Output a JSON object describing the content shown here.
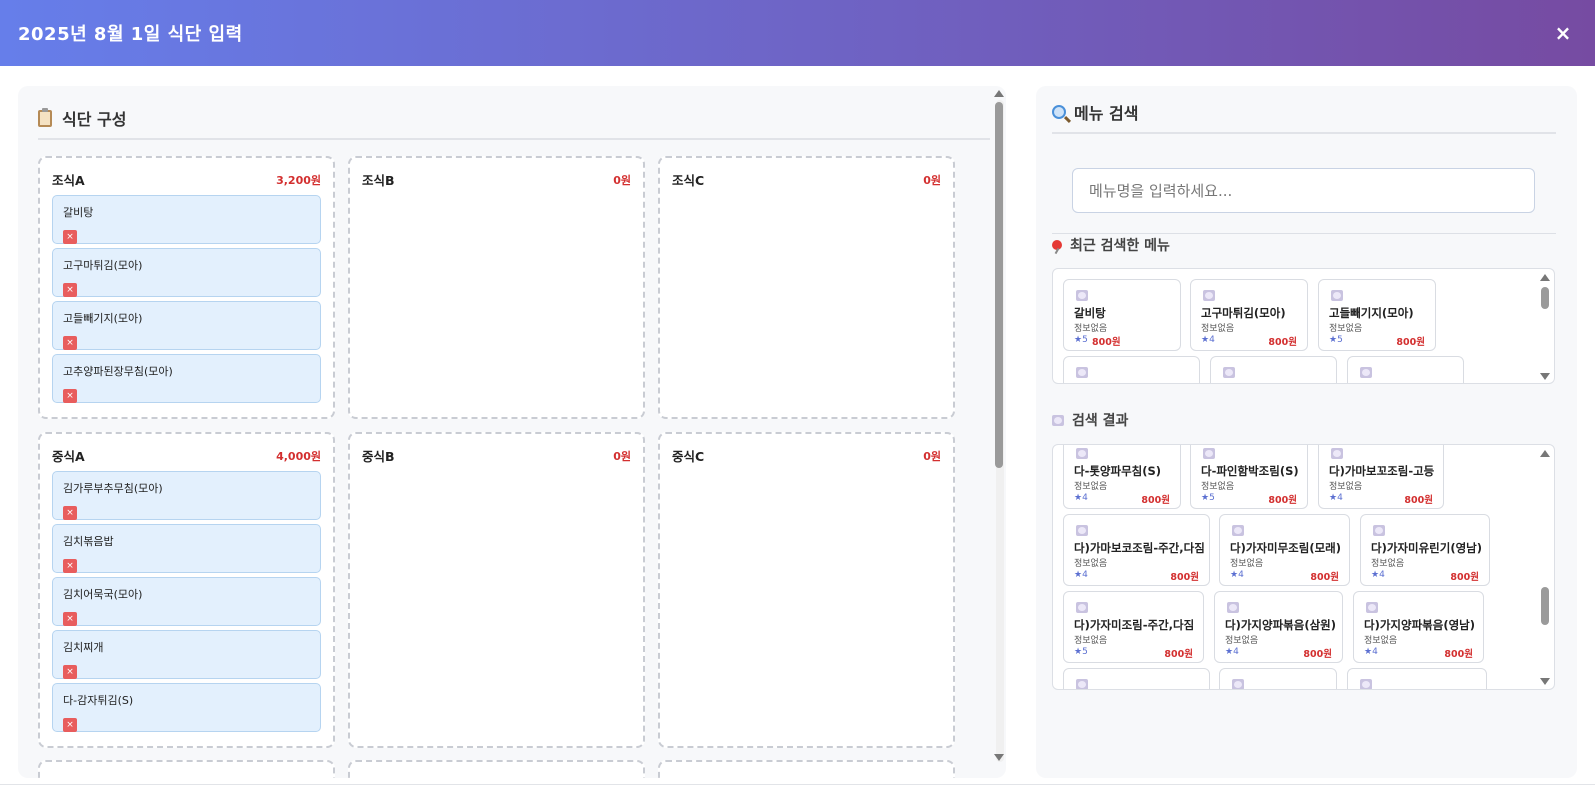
{
  "header": {
    "title": "2025년 8월 1일 식단 입력",
    "close_label": "×"
  },
  "left": {
    "title": "식단 구성",
    "meals": [
      {
        "name": "조식A",
        "price": "3,200원",
        "items": [
          "갈비탕",
          "고구마튀김(모아)",
          "고들빼기지(모아)",
          "고추양파된장무침(모아)"
        ]
      },
      {
        "name": "조식B",
        "price": "0원",
        "items": []
      },
      {
        "name": "조식C",
        "price": "0원",
        "items": []
      },
      {
        "name": "중식A",
        "price": "4,000원",
        "items": [
          "김가루부추무침(모아)",
          "김치볶음밥",
          "김치어묵국(모아)",
          "김치찌개",
          "다-감자튀김(S)"
        ]
      },
      {
        "name": "중식B",
        "price": "0원",
        "items": []
      },
      {
        "name": "중식C",
        "price": "0원",
        "items": []
      }
    ],
    "remove_label": "×"
  },
  "right": {
    "title": "메뉴 검색",
    "search": {
      "placeholder": "메뉴명을 입력하세요...",
      "value": ""
    },
    "recent_title": "최근 검색한 메뉴",
    "recent": [
      {
        "name": "갈비탕",
        "info": "정보없음",
        "rating": "★5",
        "price": "800원"
      },
      {
        "name": "고구마튀김(모아)",
        "info": "정보없음",
        "rating": "★4",
        "price": "800원"
      },
      {
        "name": "고들빼기지(모아)",
        "info": "정보없음",
        "rating": "★5",
        "price": "800원"
      }
    ],
    "results_title": "검색 결과",
    "results": [
      {
        "name": "다-톳양파무침(S)",
        "info": "정보없음",
        "rating": "★4",
        "price": "800원"
      },
      {
        "name": "다-파인함박조림(S)",
        "info": "정보없음",
        "rating": "★5",
        "price": "800원"
      },
      {
        "name": "다)가마보꼬조림-고등",
        "info": "정보없음",
        "rating": "★4",
        "price": "800원"
      },
      {
        "name": "다)가마보코조림-주간,다짐",
        "info": "정보없음",
        "rating": "★4",
        "price": "800원"
      },
      {
        "name": "다)가자미무조림(모래)",
        "info": "정보없음",
        "rating": "★4",
        "price": "800원"
      },
      {
        "name": "다)가자미유린기(영남)",
        "info": "정보없음",
        "rating": "★4",
        "price": "800원"
      },
      {
        "name": "다)가자미조림-주간,다짐",
        "info": "정보없음",
        "rating": "★5",
        "price": "800원"
      },
      {
        "name": "다)가지양파볶음(삼원)",
        "info": "정보없음",
        "rating": "★4",
        "price": "800원"
      },
      {
        "name": "다)가지양파볶음(영남)",
        "info": "정보없음",
        "rating": "★4",
        "price": "800원"
      }
    ]
  }
}
